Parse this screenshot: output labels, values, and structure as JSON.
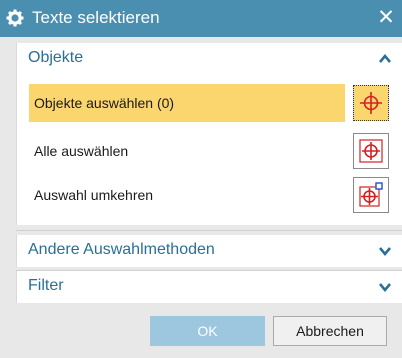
{
  "dialog": {
    "title": "Texte selektieren",
    "icon": "gear-icon",
    "close_symbol": "✕"
  },
  "groups": {
    "objects": {
      "title": "Objekte",
      "expanded": true,
      "rows": [
        {
          "label": "Objekte auswählen (0)",
          "icon": "crosshair-select-icon",
          "selected": true
        },
        {
          "label": "Alle auswählen",
          "icon": "crosshair-select-all-icon",
          "selected": false
        },
        {
          "label": "Auswahl umkehren",
          "icon": "crosshair-invert-icon",
          "selected": false
        }
      ]
    },
    "other_methods": {
      "title": "Andere Auswahlmethoden",
      "expanded": false
    },
    "filter": {
      "title": "Filter",
      "expanded": false
    }
  },
  "buttons": {
    "ok": "OK",
    "cancel": "Abbrechen"
  },
  "colors": {
    "titlebar": "#4a8fb0",
    "group_title": "#2a6f97",
    "selection": "#fbd66f",
    "ok_button": "#9cc7de"
  }
}
